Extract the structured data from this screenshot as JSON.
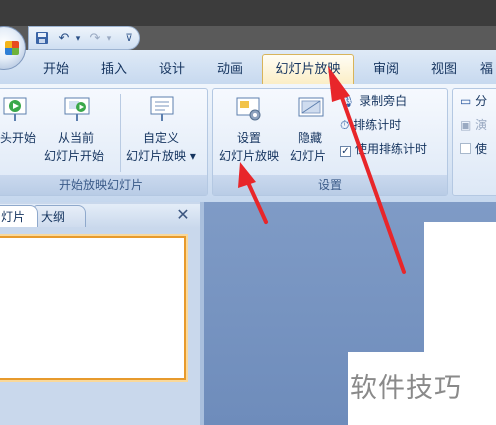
{
  "quick_access": {
    "save_icon": "save-icon",
    "undo_icon": "undo-icon",
    "redo_icon": "redo-icon",
    "customize_icon": "dropdown-arrow-icon"
  },
  "tabs": [
    {
      "label": "开始"
    },
    {
      "label": "插入"
    },
    {
      "label": "设计"
    },
    {
      "label": "动画"
    },
    {
      "label": "幻灯片放映",
      "active": true
    },
    {
      "label": "审阅"
    },
    {
      "label": "视图"
    },
    {
      "label": "福"
    }
  ],
  "ribbon": {
    "start_group": {
      "label": "开始放映幻灯片",
      "from_beginning": {
        "line1": "头开始"
      },
      "from_current": {
        "line1": "从当前",
        "line2": "幻灯片开始"
      },
      "custom": {
        "line1": "自定义",
        "line2": "幻灯片放映 ▾"
      }
    },
    "setup_group": {
      "label": "设置",
      "setup_show": {
        "line1": "设置",
        "line2": "幻灯片放映"
      },
      "hide_slide": {
        "line1": "隐藏",
        "line2": "幻灯片"
      },
      "record_narration": "录制旁白",
      "rehearse_timings": "排练计时",
      "use_rehearsed_timings": "使用排练计时"
    },
    "monitors_group": {
      "item1": "分",
      "item2": "演",
      "item3": "使"
    }
  },
  "panel": {
    "tab_slides": "灯片",
    "tab_outline": "大纲",
    "close_glyph": "✕"
  },
  "watermark": "软件技巧",
  "colors": {
    "accent_arrow": "#e8262a",
    "active_tab": "#fbeec6",
    "thumb_border": "#e79a2c"
  }
}
